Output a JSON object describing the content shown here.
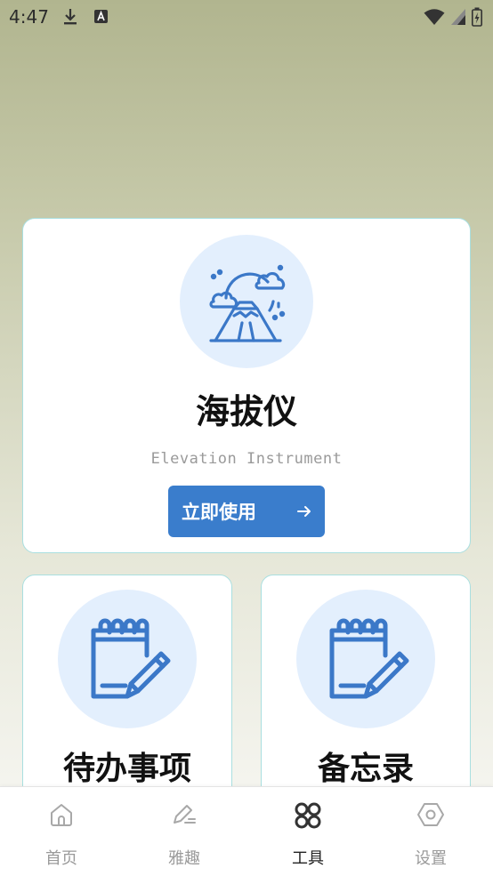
{
  "status_bar": {
    "time": "4:47",
    "icons": [
      "download-icon",
      "font-a-icon",
      "wifi-icon",
      "signal-icon",
      "battery-icon"
    ]
  },
  "main_card": {
    "icon": "mountain-sun-icon",
    "title": "海拔仪",
    "subtitle": "Elevation Instrument",
    "button_label": "立即使用",
    "button_icon": "arrow-right-icon"
  },
  "tools": [
    {
      "icon": "notepad-pencil-icon",
      "title": "待办事项"
    },
    {
      "icon": "notepad-pencil-icon",
      "title": "备忘录"
    }
  ],
  "bottom_nav": {
    "items": [
      {
        "label": "首页",
        "icon": "home-icon"
      },
      {
        "label": "雅趣",
        "icon": "pen-edit-icon"
      },
      {
        "label": "工具",
        "icon": "grid-tools-icon",
        "active": true
      },
      {
        "label": "设置",
        "icon": "hexagon-settings-icon"
      }
    ]
  },
  "colors": {
    "accent": "#3a7dcc",
    "icon_blue": "#3b78c8",
    "icon_bg": "#e3effd",
    "card_border": "#a9dfe0"
  }
}
